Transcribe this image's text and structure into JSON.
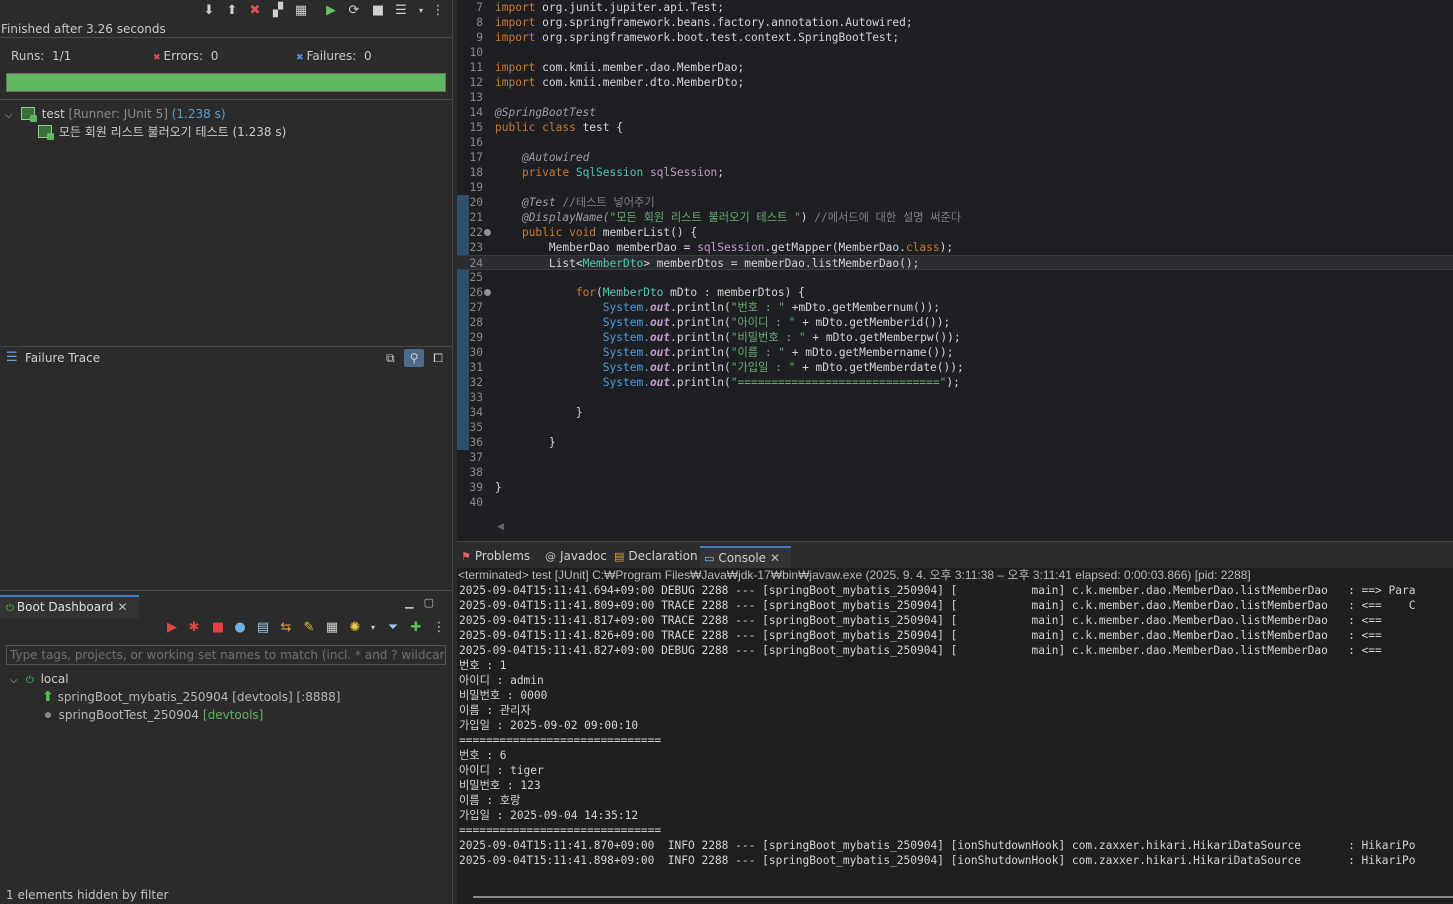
{
  "junit": {
    "status": "Finished after 3.26 seconds",
    "runs_label": "Runs:",
    "runs_value": "1/1",
    "errors_label": "Errors:",
    "errors_value": "0",
    "failures_label": "Failures:",
    "failures_value": "0",
    "progress_fraction": 1.0,
    "progress_color": "#5fb85f",
    "tree": {
      "root_name": "test",
      "root_runner": "[Runner: JUnit 5]",
      "root_time": "(1.238 s)",
      "child_name": "모든 회원 리스트 불러오기 테스트",
      "child_time": "(1.238 s)"
    },
    "failure_trace_title": "Failure Trace"
  },
  "boot": {
    "tab_label": "Boot Dashboard",
    "filter_placeholder": "Type tags, projects, or working set names to match (incl. * and ? wildcards)",
    "group_label": "local",
    "app1_name": "springBoot_mybatis_250904",
    "app1_tag": "[devtools]",
    "app1_port": "[:8888]",
    "app2_name": "springBootTest_250904",
    "app2_tag": "[devtools]",
    "status": "1 elements hidden by filter"
  },
  "editor": {
    "l7": "import org.junit.jupiter.api.Test;",
    "l8": "import org.springframework.beans.factory.annotation.Autowired;",
    "l9": "import org.springframework.boot.test.context.SpringBootTest;",
    "l11": "import com.kmii.member.dao.MemberDao;",
    "l12": "import com.kmii.member.dto.MemberDto;",
    "l14": "@SpringBootTest",
    "l15a": "public class",
    "l15b": " test {",
    "l17": "@Autowired",
    "l18a": "private",
    "l18b": " SqlSession",
    "l18c": " sqlSession",
    "l18d": ";",
    "l20a": "@Test",
    "l20b": " //테스트 넣어주기",
    "l21a": "@DisplayName(",
    "l21b": "\"모든 회원 리스트 불러오기 테스트 \"",
    "l21c": ") ",
    "l21d": "//메서드에 대한 설명 써준다",
    "l22a": "public void",
    "l22b": " memberList() {",
    "l23a": "MemberDao memberDao = ",
    "l23b": "sqlSession",
    "l23c": ".getMapper(MemberDao.",
    "l23d": "class",
    "l23e": ");",
    "l24a": "List<",
    "l24b": "MemberDto",
    "l24c": "> memberDtos = memberDao.listMemberDao();",
    "l26a": "for",
    "l26b": "(",
    "l26c": "MemberDto",
    "l26d": " mDto : memberDtos) {",
    "println": [
      {
        "s": "\"번호 : \"",
        "rest": " +mDto.getMembernum());"
      },
      {
        "s": "\"아이디 : \"",
        "rest": " + mDto.getMemberid());"
      },
      {
        "s": "\"비밀번호 : \"",
        "rest": " + mDto.getMemberpw());"
      },
      {
        "s": "\"이름 : \"",
        "rest": " + mDto.getMembername());"
      },
      {
        "s": "\"가입일 : \"",
        "rest": " + mDto.getMemberdate());"
      },
      {
        "s": "\"==============================\"",
        "rest": ");"
      }
    ],
    "sys_prefix": "System.",
    "out_field": "out",
    "println_call": ".println(",
    "close_brace": "}"
  },
  "bottom": {
    "tabs": [
      "Problems",
      "Javadoc",
      "Declaration",
      "Console"
    ],
    "console_header": "<terminated> test [JUnit] C:₩Program Files₩Java₩jdk-17₩bin₩javaw.exe  (2025. 9. 4. 오후 3:11:38 – 오후 3:11:41 elapsed: 0:00:03.866) [pid: 2288]",
    "lines": [
      "2025-09-04T15:11:41.694+09:00 DEBUG 2288 --- [springBoot_mybatis_250904] [           main] c.k.member.dao.MemberDao.listMemberDao   : ==> Para",
      "2025-09-04T15:11:41.809+09:00 TRACE 2288 --- [springBoot_mybatis_250904] [           main] c.k.member.dao.MemberDao.listMemberDao   : <==    C",
      "2025-09-04T15:11:41.817+09:00 TRACE 2288 --- [springBoot_mybatis_250904] [           main] c.k.member.dao.MemberDao.listMemberDao   : <==",
      "2025-09-04T15:11:41.826+09:00 TRACE 2288 --- [springBoot_mybatis_250904] [           main] c.k.member.dao.MemberDao.listMemberDao   : <==",
      "2025-09-04T15:11:41.827+09:00 DEBUG 2288 --- [springBoot_mybatis_250904] [           main] c.k.member.dao.MemberDao.listMemberDao   : <==",
      "번호 : 1",
      "아이디 : admin",
      "비밀번호 : 0000",
      "이름 : 관리자",
      "가입일 : 2025-09-02 09:00:10",
      "==============================",
      "번호 : 6",
      "아이디 : tiger",
      "비밀번호 : 123",
      "이름 : 호랑",
      "가입일 : 2025-09-04 14:35:12",
      "==============================",
      "2025-09-04T15:11:41.870+09:00  INFO 2288 --- [springBoot_mybatis_250904] [ionShutdownHook] com.zaxxer.hikari.HikariDataSource       : HikariPo",
      "2025-09-04T15:11:41.898+09:00  INFO 2288 --- [springBoot_mybatis_250904] [ionShutdownHook] com.zaxxer.hikari.HikariDataSource       : HikariPo"
    ]
  },
  "line_numbers": [
    "7",
    "8",
    "9",
    "10",
    "11",
    "12",
    "13",
    "14",
    "15",
    "16",
    "17",
    "18",
    "19",
    "20",
    "21",
    "22",
    "23",
    "24",
    "25",
    "26",
    "27",
    "28",
    "29",
    "30",
    "31",
    "32",
    "33",
    "34",
    "35",
    "36",
    "37",
    "38",
    "39",
    "40"
  ]
}
